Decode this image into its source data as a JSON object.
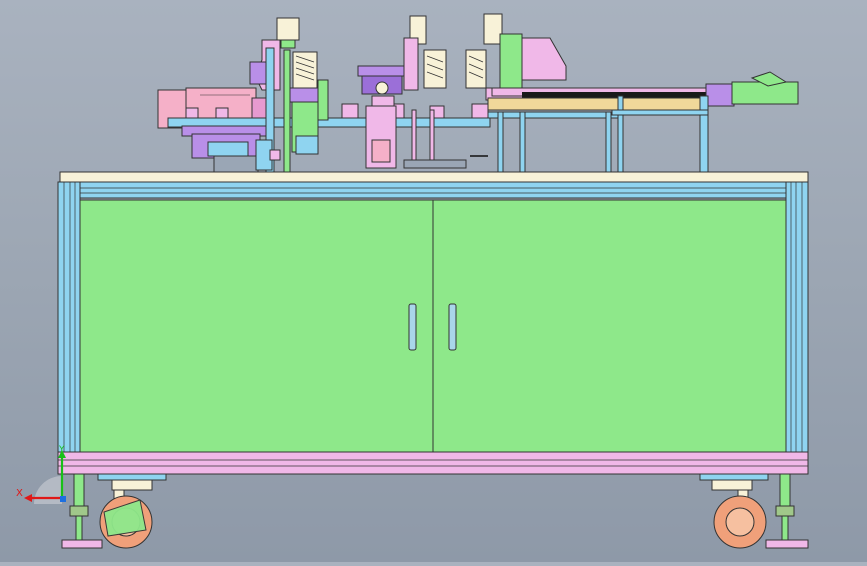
{
  "view": {
    "background_colors": [
      "#a9b2bf",
      "#8e99a8"
    ]
  },
  "triad": {
    "x_label": "X",
    "y_label": "Y",
    "x_color": "#e01818",
    "y_color": "#18c018"
  },
  "palette": {
    "cabinet_door": "#8ee88a",
    "frame_blue": "#8fd4f0",
    "frame_pink": "#f0b8e8",
    "tabletop": "#f8f2d8",
    "wheel": "#f0a07a",
    "motor": "#f5b0c8",
    "fixture_purple": "#b98fe8",
    "rail_tan": "#f0d89a"
  }
}
